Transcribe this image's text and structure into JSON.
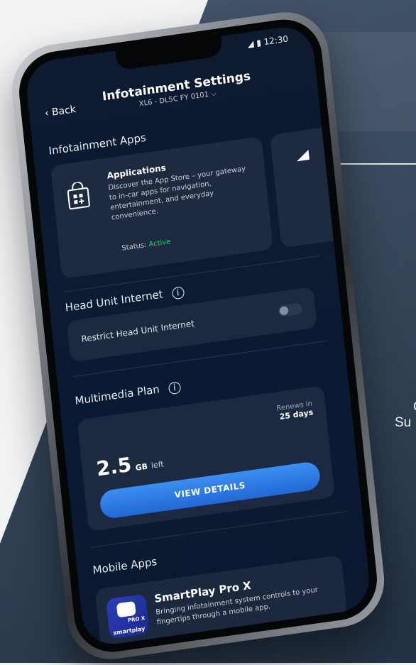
{
  "colors": {
    "accent": "#2f80ee",
    "active": "#25d06b",
    "screen_bg": "#0c1a31"
  },
  "status_bar": {
    "time": "12:30"
  },
  "header": {
    "back_label": "Back",
    "title": "Infotainment Settings",
    "vehicle": "XL6 - DL5C FY 0101"
  },
  "infotainment_apps": {
    "title": "Infotainment Apps",
    "card": {
      "icon": "shopping-bag-icon",
      "name": "Applications",
      "description": "Discover the App Store – your gateway to in-car apps for navigation, entertainment, and everyday convenience.",
      "status_label": "Status:",
      "status_value": "Active"
    }
  },
  "head_unit_internet": {
    "title": "Head Unit Internet",
    "toggle_label": "Restrict Head Unit Internet",
    "toggle_on": false
  },
  "multimedia_plan": {
    "title": "Multimedia Plan",
    "renews_label": "Renews in",
    "renews_value": "25 days",
    "data_amount": "2.5",
    "data_unit": "GB",
    "data_suffix": "left",
    "button_label": "VIEW DETAILS"
  },
  "mobile_apps": {
    "title": "Mobile Apps",
    "app_name": "SmartPlay Pro X",
    "app_description": "Bringing infotainment system controls to your fingertips through a mobile app.",
    "icon_pro": "PRO X",
    "icon_brand": "smartplay"
  },
  "side_text": {
    "line1": "C",
    "line2": "Su"
  }
}
